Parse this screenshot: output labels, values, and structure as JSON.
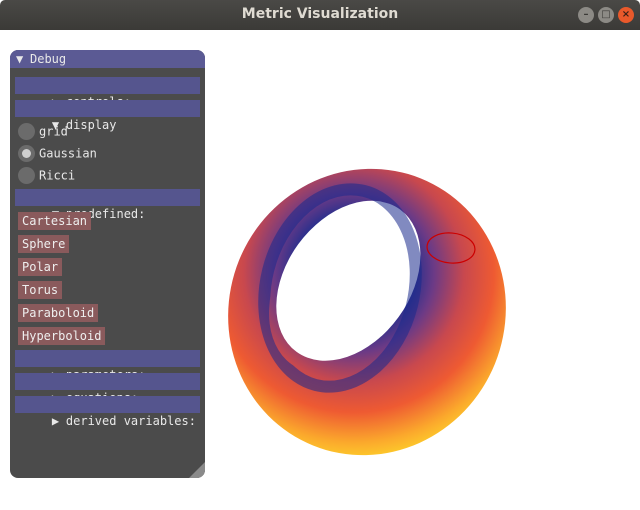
{
  "window": {
    "title": "Metric Visualization",
    "controls": {
      "minimize": "–",
      "maximize": "□",
      "close": "×"
    }
  },
  "panel": {
    "title": "Debug",
    "title_arrow": "▼",
    "sections": {
      "controls": {
        "label": "controls:",
        "arrow": "▶"
      },
      "display": {
        "label": "display",
        "arrow": "▼"
      },
      "predefined": {
        "label": "predefined:",
        "arrow": "▼"
      },
      "parameters": {
        "label": "parameters:",
        "arrow": "▶"
      },
      "equations": {
        "label": "equations:",
        "arrow": "▶"
      },
      "derived": {
        "label": "derived variables:",
        "arrow": "▶"
      }
    },
    "display_options": [
      {
        "label": "grid",
        "selected": false
      },
      {
        "label": "Gaussian",
        "selected": true
      },
      {
        "label": "Ricci",
        "selected": false
      }
    ],
    "predefined_buttons": [
      "Cartesian",
      "Sphere",
      "Polar",
      "Torus",
      "Paraboloid",
      "Hyperboloid"
    ]
  },
  "colors": {
    "panel_bg": "#4b4b4b",
    "header_bg": "#55558e",
    "button_bg": "#8a5a5c",
    "surface_inner": "#1a2a8c",
    "surface_outer": "#ffe82a",
    "marker": "#cc0000"
  }
}
